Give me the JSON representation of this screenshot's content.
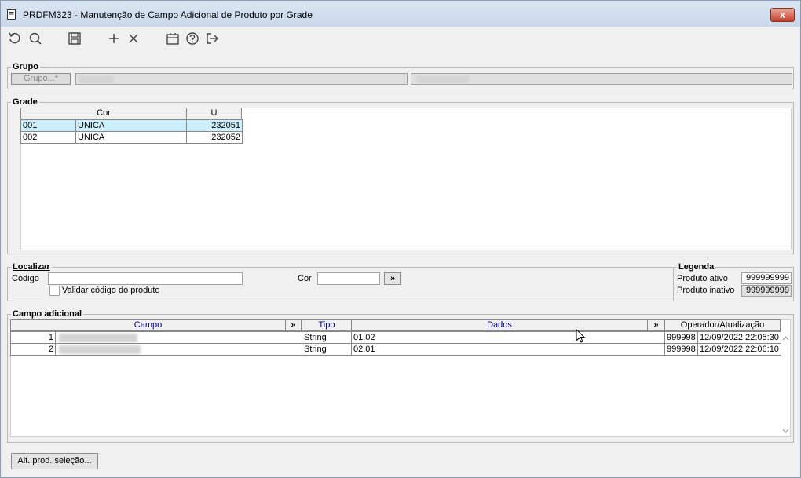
{
  "window": {
    "title": "PRDFM323 - Manutenção de Campo Adicional de Produto por Grade",
    "close_label": "x"
  },
  "toolbar": {
    "icons": [
      "undo-icon",
      "search-icon",
      "save-icon",
      "add-icon",
      "delete-icon",
      "calendar-icon",
      "help-icon",
      "exit-icon"
    ]
  },
  "grupo": {
    "legend": "Grupo",
    "button_label": "Grupo...*"
  },
  "grade": {
    "legend": "Grade",
    "columns": [
      "Cor",
      "U"
    ],
    "rows": [
      {
        "code": "001",
        "cor": "UNICA",
        "u": "232051"
      },
      {
        "code": "002",
        "cor": "UNICA",
        "u": "232052"
      }
    ]
  },
  "localizar": {
    "legend": "Localizar",
    "codigo_label": "Código",
    "codigo_value": "",
    "cor_label": "Cor",
    "cor_value": "",
    "go_label": "»",
    "validar_label": "Validar código do produto",
    "validar_checked": false
  },
  "legenda": {
    "legend": "Legenda",
    "ativo_label": "Produto ativo",
    "ativo_value": "999999999",
    "inativo_label": "Produto inativo",
    "inativo_value": "999999999"
  },
  "campo_adicional": {
    "legend": "Campo adicional",
    "columns": {
      "campo": "Campo",
      "expand": "»",
      "tipo": "Tipo",
      "dados": "Dados",
      "operador": "Operador/Atualização"
    },
    "rows": [
      {
        "num": "1",
        "tipo": "String",
        "dados": "01.02",
        "operador": "999998",
        "data": "12/09/2022 22:05:30"
      },
      {
        "num": "2",
        "tipo": "String",
        "dados": "02.01",
        "operador": "999998",
        "data": "12/09/2022 22:06:10"
      }
    ]
  },
  "footer": {
    "alt_button_label": "Alt. prod. seleção..."
  },
  "colors": {
    "selected_row": "#cdeefb",
    "header_blue": "#00008b",
    "close_red": "#c6402a"
  }
}
